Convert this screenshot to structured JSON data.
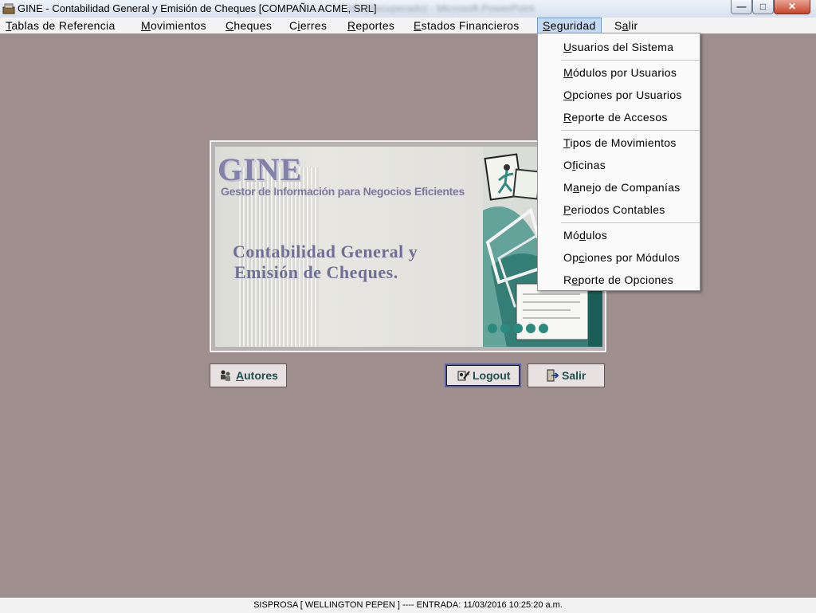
{
  "window": {
    "title": "GINE - Contabilidad General y Emisión de Cheques [COMPAÑIA ACME, SRL]",
    "title_blurred": "...ión (Recuperado) - Microsoft PowerPoint",
    "min_glyph": "—",
    "max_glyph": "□",
    "close_glyph": "✕"
  },
  "menu": [
    {
      "pre": "",
      "u": "T",
      "post": "ablas de Referencia"
    },
    {
      "pre": "",
      "u": "M",
      "post": "ovimientos"
    },
    {
      "pre": "",
      "u": "C",
      "post": "heques"
    },
    {
      "pre": "C",
      "u": "i",
      "post": "erres"
    },
    {
      "pre": "",
      "u": "R",
      "post": "eportes"
    },
    {
      "pre": "",
      "u": "E",
      "post": "stados Financieros"
    },
    {
      "pre": "",
      "u": "S",
      "post": "eguridad"
    },
    {
      "pre": "S",
      "u": "a",
      "post": "lir"
    }
  ],
  "dropdown": [
    {
      "pre": "",
      "u": "U",
      "post": "suarios del Sistema"
    },
    {
      "pre": "",
      "u": "M",
      "post": "ódulos por Usuarios"
    },
    {
      "pre": "",
      "u": "O",
      "post": "pciones por Usuarios"
    },
    {
      "pre": "",
      "u": "R",
      "post": "eporte de Accesos"
    },
    {
      "pre": "",
      "u": "T",
      "post": "ipos de Movimientos"
    },
    {
      "pre": "O",
      "u": "f",
      "post": "icinas"
    },
    {
      "pre": "M",
      "u": "a",
      "post": "nejo de Companías"
    },
    {
      "pre": "",
      "u": "P",
      "post": "eriodos Contables"
    },
    {
      "pre": "Mó",
      "u": "d",
      "post": "ulos"
    },
    {
      "pre": "Op",
      "u": "c",
      "post": "iones por Módulos"
    },
    {
      "pre": "R",
      "u": "e",
      "post": "porte de Opciones"
    }
  ],
  "splash": {
    "logo": "GINE",
    "subtitle": "Gestor de Información para Negocios Eficientes",
    "line1": "Contabilidad General  y",
    "line2": "Emisión de Cheques."
  },
  "buttons": {
    "autores": {
      "u": "A",
      "post": "utores"
    },
    "logout": {
      "label": "Logout"
    },
    "salir": {
      "label": "Salir"
    }
  },
  "status": "SISPROSA [ WELLINGTON PEPEN ] ---- ENTRADA: 11/03/2016 10:25:20 a.m.",
  "colors": {
    "desktop": "#9e8e8e",
    "accent_text": "#1d4f4f",
    "logo": "#8481a8",
    "menu_highlight": "#c4d9f2"
  }
}
